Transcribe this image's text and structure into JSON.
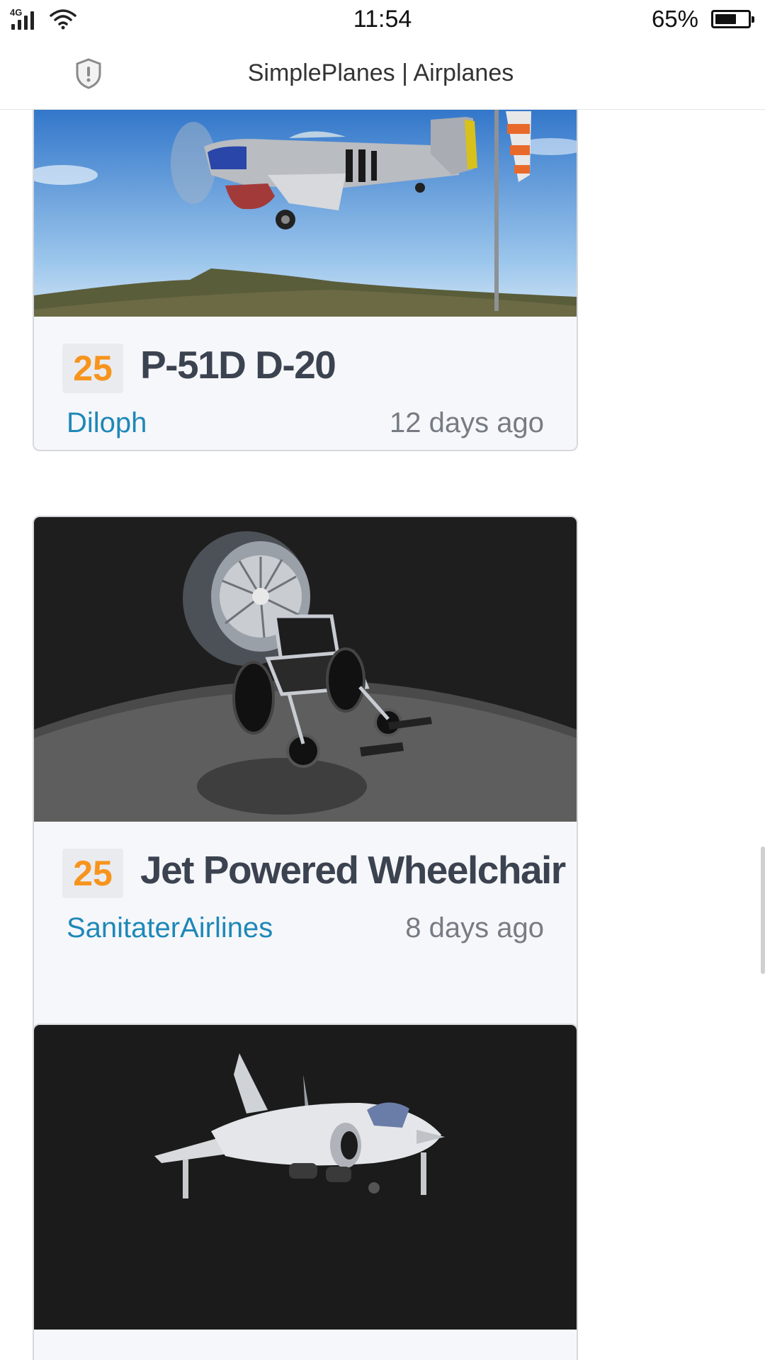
{
  "status_bar": {
    "network": "4G",
    "time": "11:54",
    "battery_pct": "65%",
    "battery_level": 0.65
  },
  "header": {
    "title": "SimplePlanes | Airplanes",
    "security_icon": "shield-alert-icon"
  },
  "posts": [
    {
      "score": "25",
      "title": "P-51D D-20",
      "author": "Diloph",
      "age": "12 days ago",
      "thumbnail": "p51-plane-image"
    },
    {
      "score": "25",
      "title": "Jet Powered Wheelchair",
      "author": "SanitaterAirlines",
      "age": "8 days ago",
      "thumbnail": "jet-wheelchair-image"
    },
    {
      "score": "",
      "title": "",
      "author": "",
      "age": "",
      "thumbnail": "harrier-jet-image"
    }
  ],
  "colors": {
    "score": "#f7941d",
    "author": "#1e88b8",
    "title": "#3c4350",
    "card_bg": "#f6f7fa"
  }
}
